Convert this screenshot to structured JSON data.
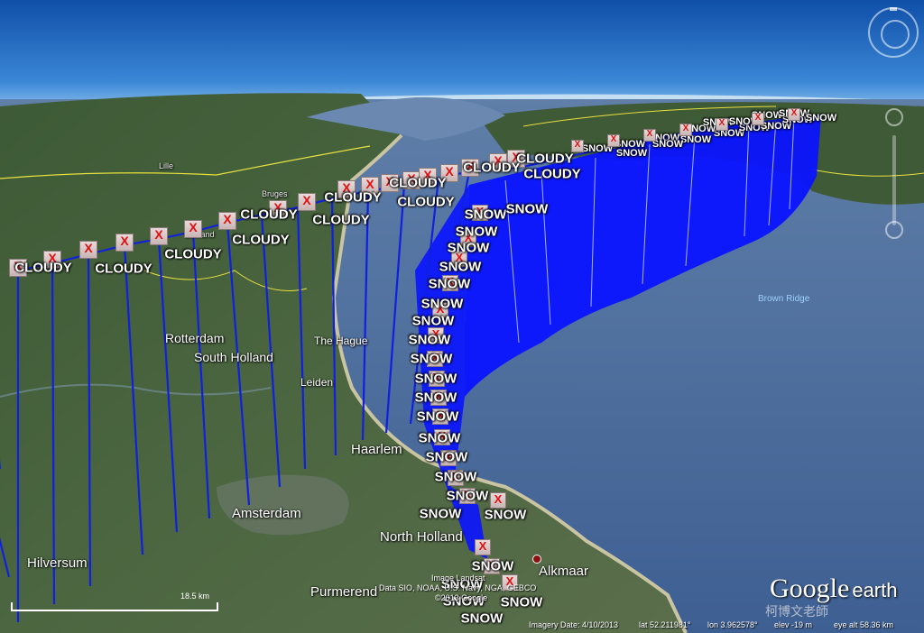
{
  "app": {
    "name": "Google earth",
    "logo_google": "Google",
    "logo_earth": "earth"
  },
  "watermark": "柯博文老師",
  "scale": {
    "label": "18.5 km"
  },
  "status": {
    "imagery_date": "Imagery Date: 4/10/2013",
    "lat": "lat  52.211981°",
    "lon": "lon  3.962578°",
    "elev": "elev  -19 m",
    "eye_alt": "eye alt  58.36 km"
  },
  "attribution": {
    "line1": "Image Landsat",
    "line2": "Data SIO, NOAA, U.S. Navy, NGA, GEBCO",
    "line3": "©2013 Google"
  },
  "places": [
    {
      "id": "rotterdam",
      "label": "Rotterdam",
      "cls": ""
    },
    {
      "id": "south-holland",
      "label": "South Holland",
      "cls": ""
    },
    {
      "id": "the-hague",
      "label": "The Hague",
      "cls": "sm"
    },
    {
      "id": "leiden",
      "label": "Leiden",
      "cls": "sm"
    },
    {
      "id": "haarlem",
      "label": "Haarlem",
      "cls": "big"
    },
    {
      "id": "amsterdam",
      "label": "Amsterdam",
      "cls": "big"
    },
    {
      "id": "north-holland",
      "label": "North Holland",
      "cls": "big"
    },
    {
      "id": "hilversum",
      "label": "Hilversum",
      "cls": "big"
    },
    {
      "id": "purmerend",
      "label": "Purmerend",
      "cls": "big"
    },
    {
      "id": "alkmaar",
      "label": "Alkmaar",
      "cls": "big"
    },
    {
      "id": "zeeland",
      "label": "Zeeland",
      "cls": "tiny"
    },
    {
      "id": "bruges",
      "label": "Bruges",
      "cls": "tiny"
    },
    {
      "id": "lille",
      "label": "Lille",
      "cls": "tiny"
    },
    {
      "id": "brown-ridge",
      "label": "Brown Ridge",
      "cls": "water"
    }
  ],
  "weather": {
    "cloudy_label": "CLOUDY",
    "snow_label": "SNOW",
    "marker_glyph": "X",
    "colors": {
      "curtain": "#0a14ff",
      "line": "#1020e0",
      "marker": "#e01010"
    }
  }
}
